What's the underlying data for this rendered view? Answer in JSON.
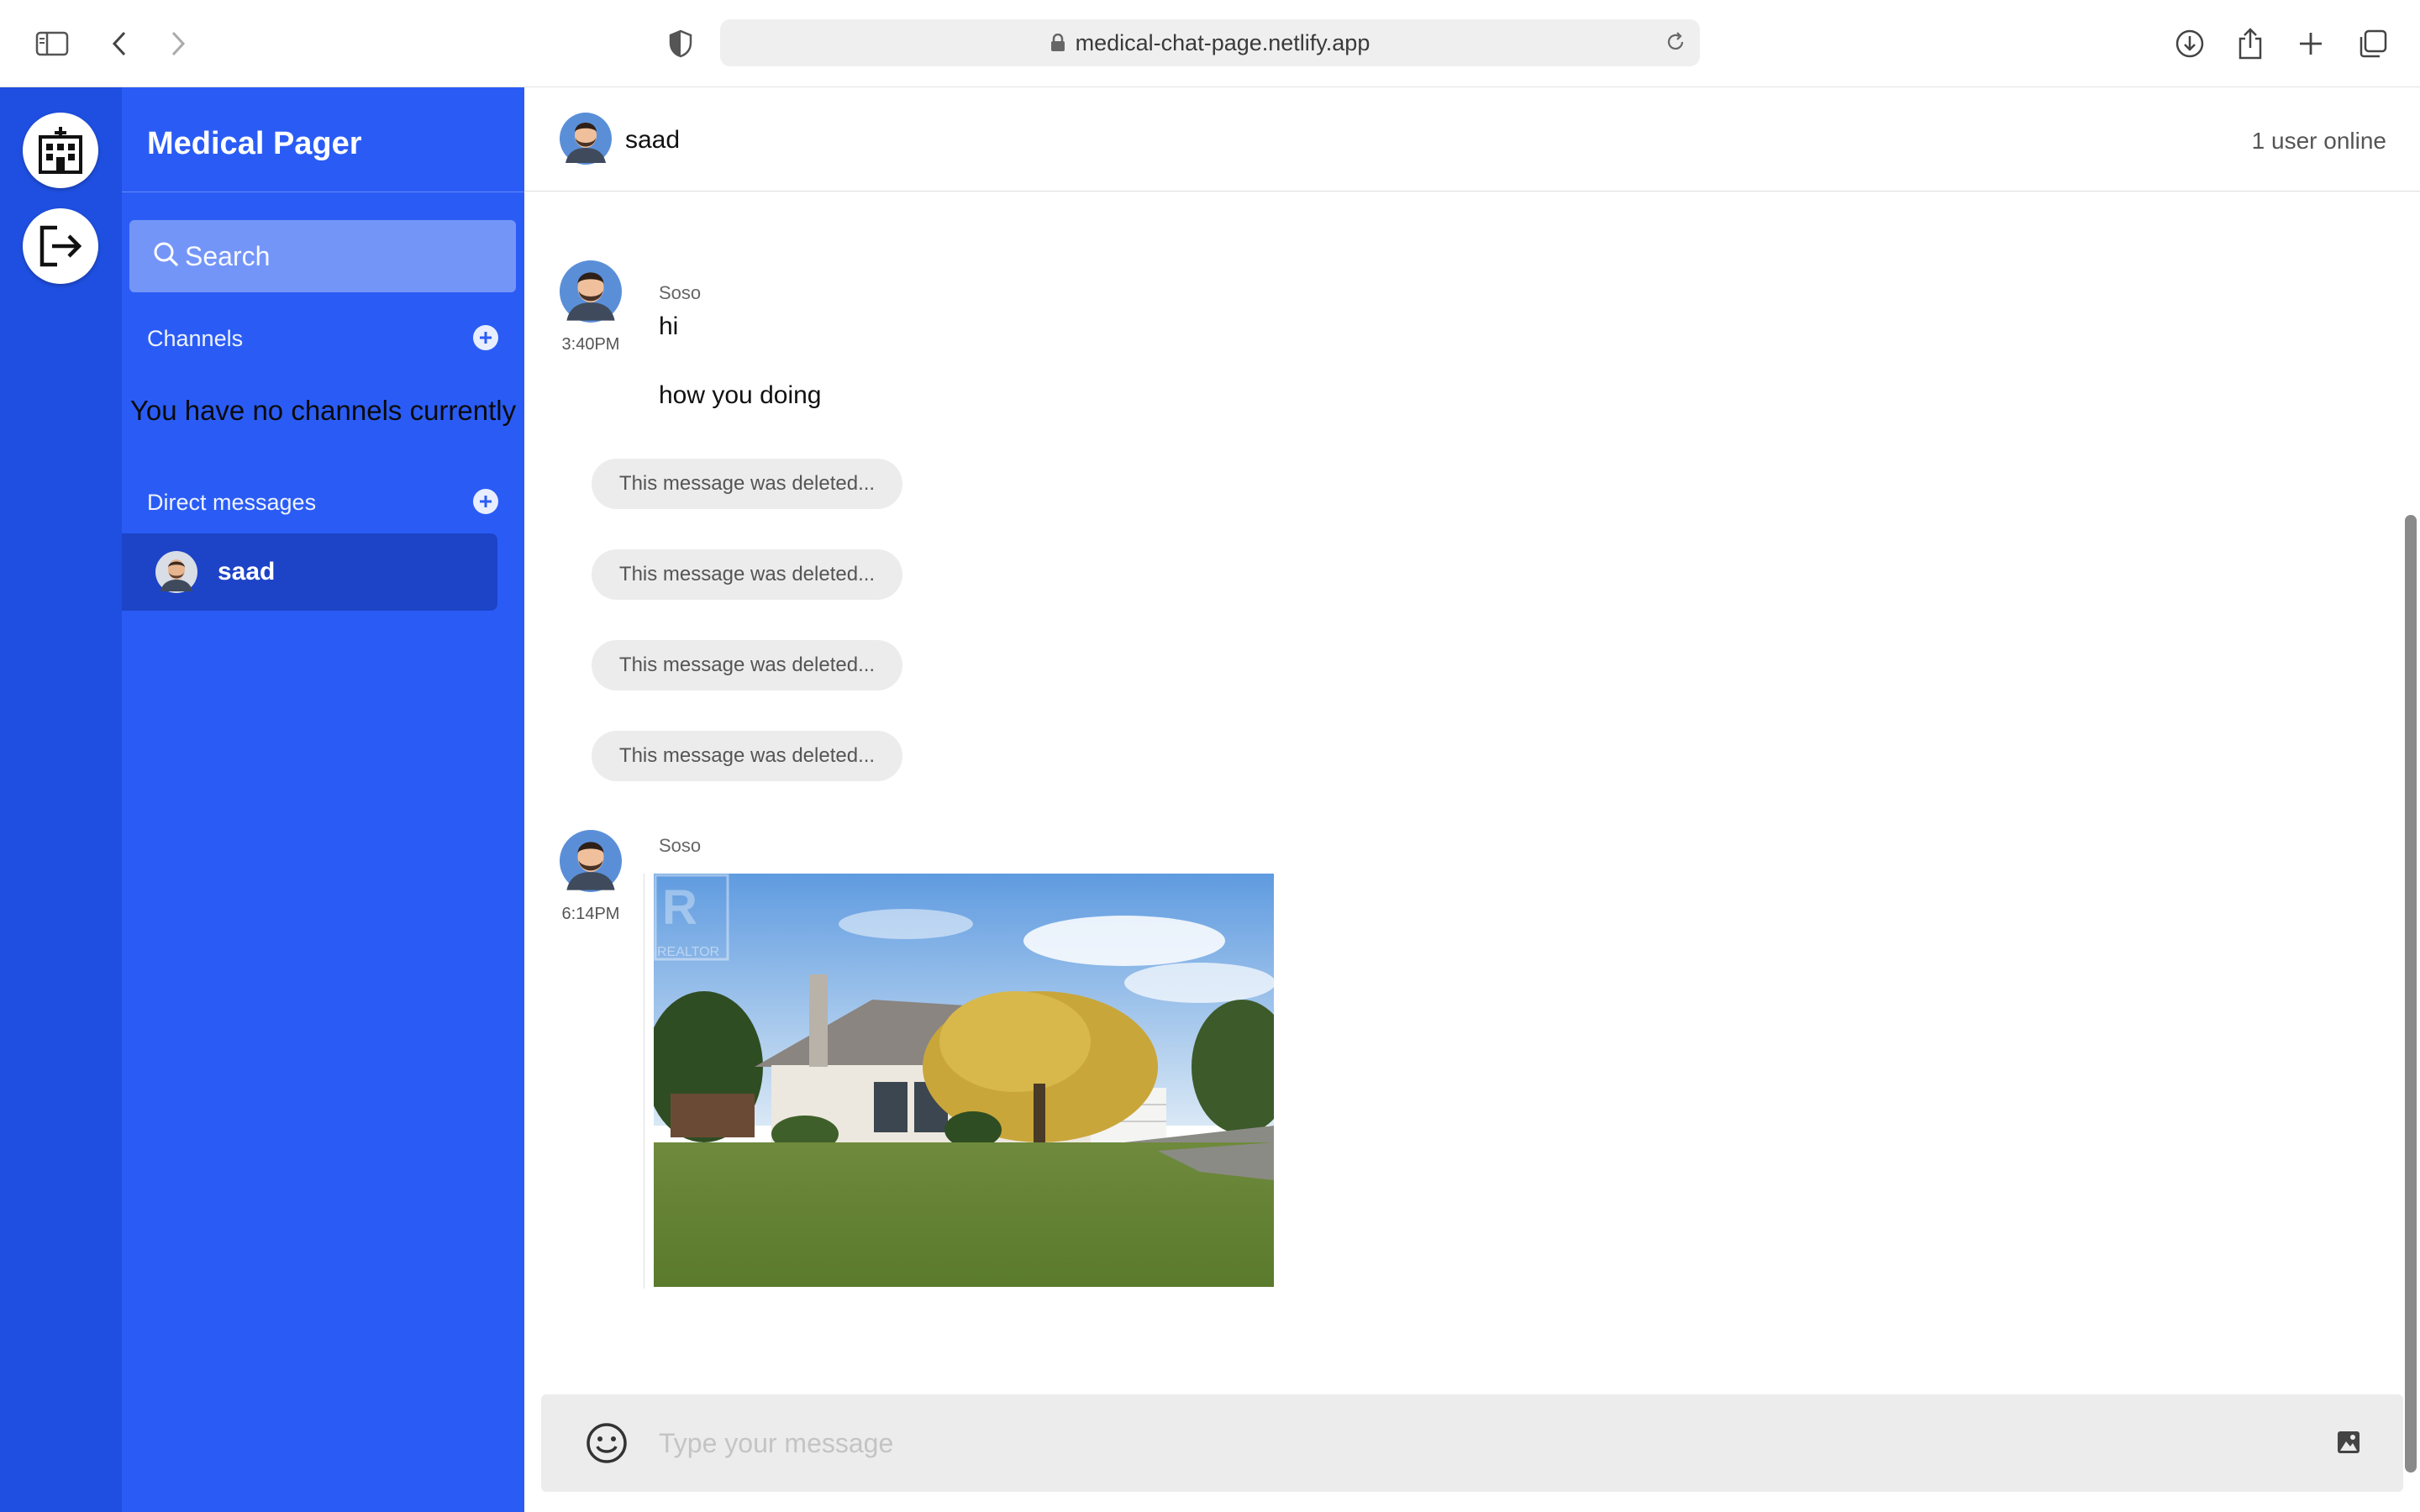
{
  "browser": {
    "url": "medical-chat-page.netlify.app"
  },
  "rail": {
    "items": [
      "hospital-icon",
      "logout-icon"
    ]
  },
  "sidebar": {
    "title": "Medical Pager",
    "search_placeholder": "Search",
    "channels_label": "Channels",
    "channels_empty": "You have no channels currently",
    "dm_label": "Direct messages",
    "dm_items": [
      {
        "name": "saad"
      }
    ]
  },
  "header": {
    "name": "saad",
    "online": "1 user online"
  },
  "messages": {
    "group1": {
      "author": "Soso",
      "time": "3:40PM",
      "lines": [
        "hi",
        "how you doing"
      ]
    },
    "deleted": [
      "This message was deleted...",
      "This message was deleted...",
      "This message was deleted...",
      "This message was deleted..."
    ],
    "group2": {
      "author": "Soso",
      "time": "6:14PM",
      "image": "house-photo",
      "image_watermark": "REALTOR"
    }
  },
  "composer": {
    "placeholder": "Type your message"
  },
  "colors": {
    "rail": "#1f4fe0",
    "sidebar": "#2a5cf5",
    "active_item": "#1d43c7"
  }
}
